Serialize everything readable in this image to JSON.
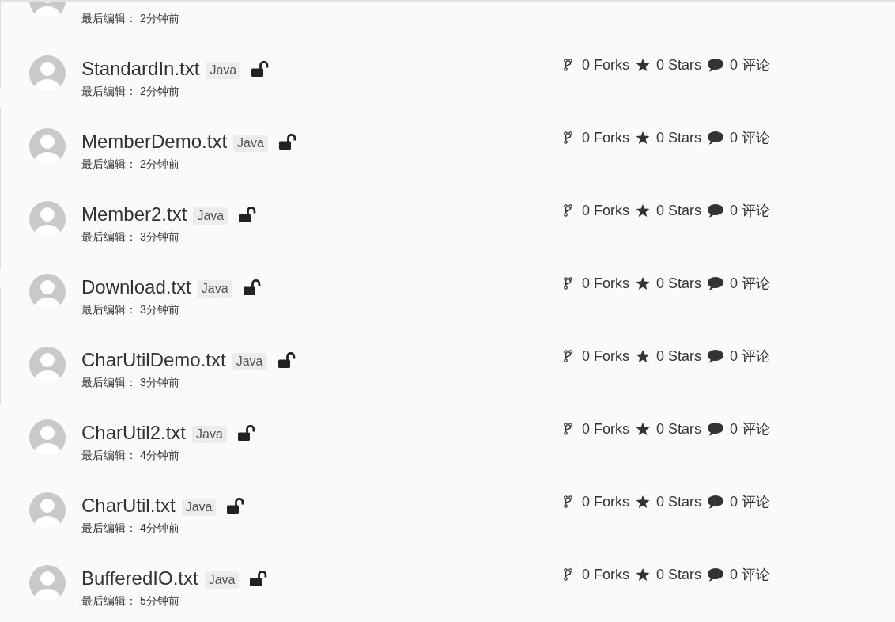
{
  "files": [
    {
      "edited": "最后编辑： 2分钟前"
    },
    {
      "title": "StandardIn.txt",
      "tag": "Java",
      "locked": false,
      "edited": "最后编辑： 2分钟前",
      "forks": "0 Forks",
      "stars": "0 Stars",
      "comments": "0 评论"
    },
    {
      "title": "MemberDemo.txt",
      "tag": "Java",
      "locked": false,
      "edited": "最后编辑： 2分钟前",
      "forks": "0 Forks",
      "stars": "0 Stars",
      "comments": "0 评论"
    },
    {
      "title": "Member2.txt",
      "tag": "Java",
      "locked": false,
      "edited": "最后编辑： 3分钟前",
      "forks": "0 Forks",
      "stars": "0 Stars",
      "comments": "0 评论"
    },
    {
      "title": "Download.txt",
      "tag": "Java",
      "locked": false,
      "edited": "最后编辑： 3分钟前",
      "forks": "0 Forks",
      "stars": "0 Stars",
      "comments": "0 评论"
    },
    {
      "title": "CharUtilDemo.txt",
      "tag": "Java",
      "locked": false,
      "edited": "最后编辑： 3分钟前",
      "forks": "0 Forks",
      "stars": "0 Stars",
      "comments": "0 评论"
    },
    {
      "title": "CharUtil2.txt",
      "tag": "Java",
      "locked": false,
      "edited": "最后编辑： 4分钟前",
      "forks": "0 Forks",
      "stars": "0 Stars",
      "comments": "0 评论"
    },
    {
      "title": "CharUtil.txt",
      "tag": "Java",
      "locked": false,
      "edited": "最后编辑： 4分钟前",
      "forks": "0 Forks",
      "stars": "0 Stars",
      "comments": "0 评论"
    },
    {
      "title": "BufferedIO.txt",
      "tag": "Java",
      "locked": false,
      "edited": "最后编辑： 5分钟前",
      "forks": "0 Forks",
      "stars": "0 Stars",
      "comments": "0 评论"
    }
  ]
}
